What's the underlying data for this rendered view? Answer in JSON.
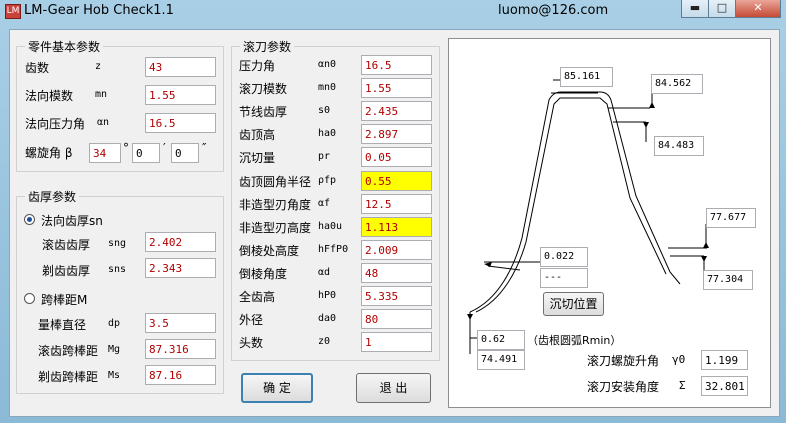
{
  "window": {
    "title": "LM-Gear Hob Check1.1",
    "email": "luomo@126.com",
    "icon_color": "#c8423b",
    "controls": {
      "minimize": "▬",
      "maximize": "□",
      "close": "✕"
    }
  },
  "part": {
    "title": "零件基本参数",
    "teeth": {
      "label": "齿数",
      "sym": "z",
      "value": "43"
    },
    "module": {
      "label": "法向模数",
      "sym": "mn",
      "value": "1.55"
    },
    "pressure_angle": {
      "label": "法向压力角",
      "sym": "αn",
      "value": "16.5"
    },
    "helix": {
      "label": "螺旋角 β",
      "deg": "34",
      "deg_unit": "°",
      "min": "0",
      "min_unit": "′",
      "sec": "0",
      "sec_unit": "″"
    }
  },
  "thickness": {
    "title": "齿厚参数",
    "normal_option": "法向齿厚sn",
    "roll_label": "滚齿齿厚",
    "roll_sym": "sng",
    "roll_value": "2.402",
    "shave_label": "剃齿齿厚",
    "shave_sym": "sns",
    "shave_value": "2.343",
    "pin_option": "跨棒距M",
    "pin_label": "量棒直径",
    "pin_sym": "dp",
    "pin_value": "3.5",
    "roll_span_label": "滚齿跨棒距",
    "roll_span_sym": "Mg",
    "roll_span_value": "87.316",
    "shave_span_label": "剃齿跨棒距",
    "shave_span_sym": "Ms",
    "shave_span_value": "87.16"
  },
  "hob": {
    "title": "滚刀参数",
    "rows": [
      {
        "label": "压力角",
        "sym": "αn0",
        "value": "16.5"
      },
      {
        "label": "滚刀模数",
        "sym": "mn0",
        "value": "1.55"
      },
      {
        "label": "节线齿厚",
        "sym": "s0",
        "value": "2.435"
      },
      {
        "label": "齿顶高",
        "sym": "ha0",
        "value": "2.897"
      },
      {
        "label": "沉切量",
        "sym": "pr",
        "value": "0.05"
      },
      {
        "label": "齿顶圆角半径",
        "sym": "ρfp",
        "value": "0.55"
      },
      {
        "label": "非造型刃角度",
        "sym": "αf",
        "value": "12.5"
      },
      {
        "label": "非造型刃高度",
        "sym": "ha0u",
        "value": "1.113"
      },
      {
        "label": "倒棱处高度",
        "sym": "hFfP0",
        "value": "2.009"
      },
      {
        "label": "倒棱角度",
        "sym": "αd",
        "value": "48"
      },
      {
        "label": "全齿高",
        "sym": "hP0",
        "value": "5.335"
      },
      {
        "label": "外径",
        "sym": "da0",
        "value": "80"
      },
      {
        "label": "头数",
        "sym": "z0",
        "value": "1"
      }
    ]
  },
  "buttons": {
    "ok": "确 定",
    "exit": "退 出",
    "undercut": "沉切位置"
  },
  "diagram": {
    "top": "85.161",
    "right1": "84.562",
    "right2": "84.483",
    "right3": "77.677",
    "right4": "77.304",
    "small1": "0.022",
    "small2": "---",
    "root_r": "0.62",
    "root_note": "（齿根圆弧Rmin）",
    "bottom": "74.491"
  },
  "output": {
    "lead_label": "滚刀螺旋升角",
    "lead_sym": "γ0",
    "lead_value": "1.199",
    "install_label": "滚刀安装角度",
    "install_sym": "Σ",
    "install_value": "32.801"
  }
}
